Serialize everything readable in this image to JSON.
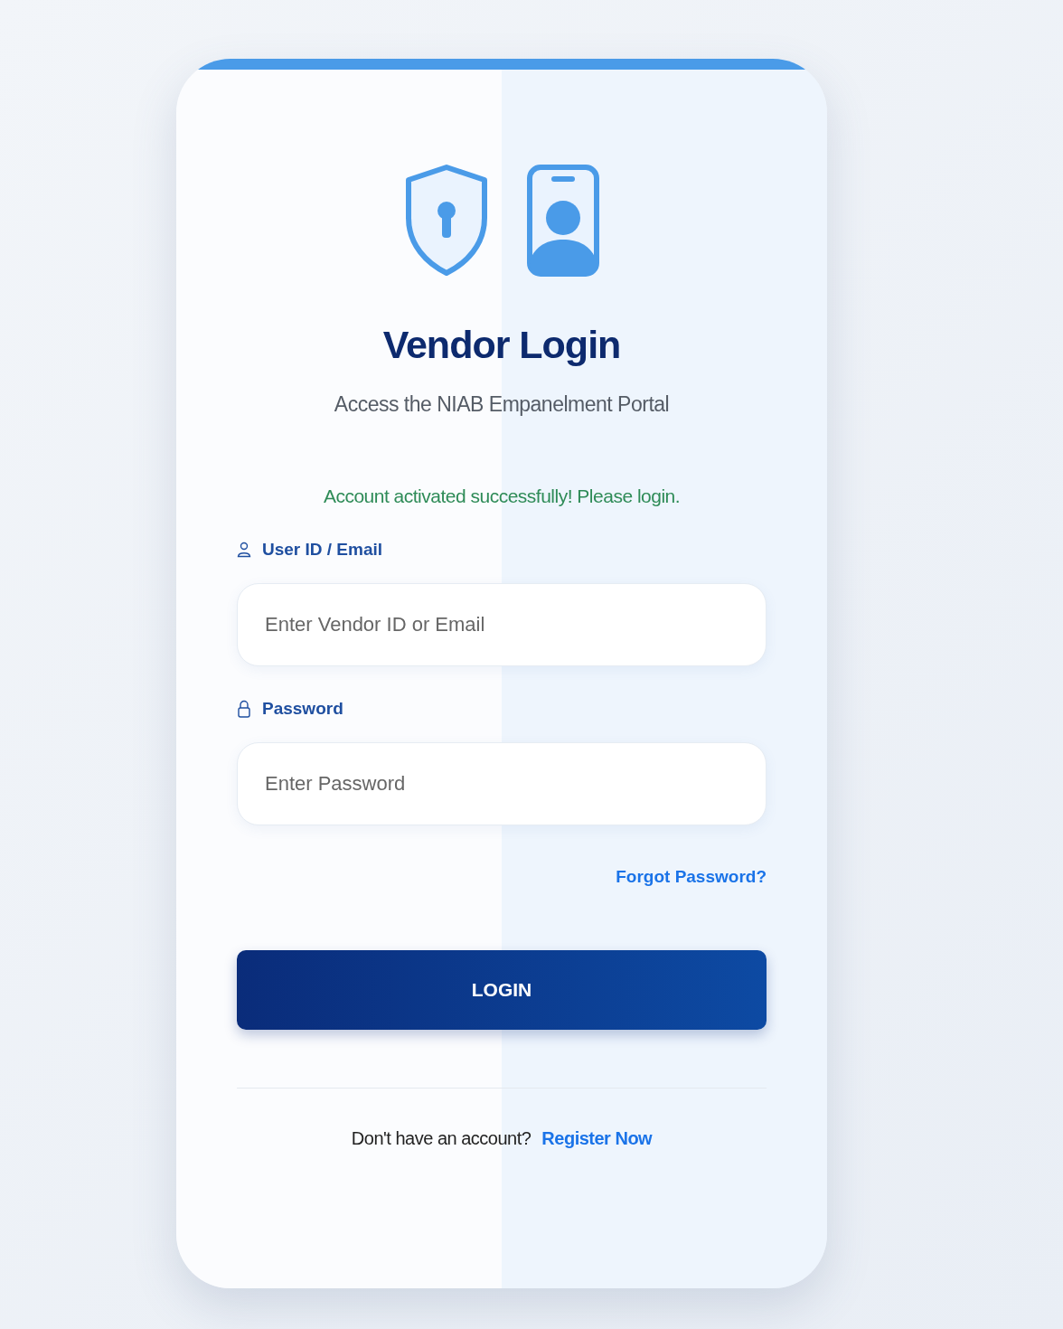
{
  "title": "Vendor Login",
  "subtitle": "Access the NIAB Empanelment Portal",
  "message": {
    "kind": "success",
    "text": "Account activated successfully! Please login."
  },
  "fields": [
    {
      "kind": "user",
      "label": "User ID / Email",
      "placeholder": "Enter Vendor ID or Email"
    },
    {
      "kind": "password",
      "label": "Password",
      "placeholder": "Enter Password"
    }
  ],
  "forgot_link": "Forgot Password?",
  "login_button": "LOGIN",
  "footer": {
    "text": "Don't have an account?",
    "link": "Register Now"
  }
}
